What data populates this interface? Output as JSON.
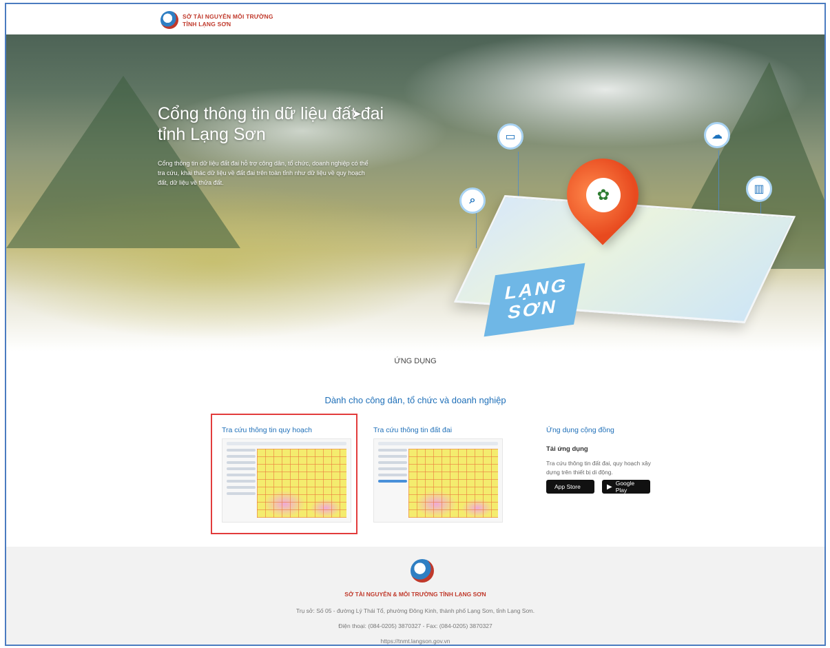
{
  "header": {
    "brand_line1": "SỞ TÀI NGUYÊN MÔI TRƯỜNG",
    "brand_line2": "TỈNH LẠNG SƠN"
  },
  "hero": {
    "title_line1": "Cổng thông tin dữ liệu đất đai",
    "title_line2": "tỉnh Lạng Sơn",
    "description": "Cổng thông tin dữ liệu đất đai hỗ trợ công dân, tổ chức, doanh nghiệp có thể tra cứu, khai thác dữ liệu về đất đai trên toàn tỉnh như dữ liệu về quy hoạch đất, dữ liệu về thửa đất.",
    "map_label_1": "LẠNG",
    "map_label_2": "SƠN",
    "icons": [
      "device-icon",
      "search-icon",
      "cloud-icon",
      "chart-icon"
    ]
  },
  "apps": {
    "section_label": "ỨNG DỤNG",
    "section_title": "Dành cho công dân, tổ chức và doanh nghiệp",
    "items": [
      {
        "title": "Tra cứu thông tin quy hoạch",
        "highlighted": true
      },
      {
        "title": "Tra cứu thông tin đất đai",
        "highlighted": false
      }
    ],
    "community": {
      "title": "Ứng dụng cộng đồng",
      "subtitle": "Tải ứng dụng",
      "description": "Tra cứu thông tin đất đai, quy hoạch xây dựng trên thiết bị di động.",
      "app_store": "App Store",
      "google_play": "Google Play"
    }
  },
  "footer": {
    "org_name": "SỞ TÀI NGUYÊN & MÔI TRƯỜNG TỈNH LẠNG SƠN",
    "address": "Trụ sở: Số 05 - đường Lý Thái Tổ, phường Đông Kinh, thành phố Lạng Sơn, tỉnh Lạng Sơn.",
    "phone": "Điện thoại: (084-0205) 3870327 - Fax: (084-0205) 3870327",
    "website": "https://tnmt.langson.gov.vn"
  },
  "colors": {
    "accent": "#1e6fb8",
    "brand_red": "#c0392b",
    "highlight": "#e23b3b"
  }
}
